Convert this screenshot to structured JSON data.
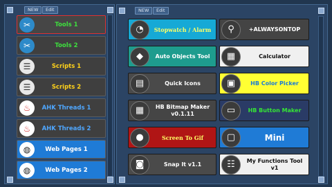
{
  "left": {
    "new_label": "NEW",
    "edit_label": "Edit",
    "items": [
      {
        "label": "Tools 1",
        "icon": "tools-icon",
        "bg": "#3f3f3f",
        "fg": "#3ee03e",
        "selected": true
      },
      {
        "label": "Tools 2",
        "icon": "tools-icon",
        "bg": "#3f3f3f",
        "fg": "#3ee03e"
      },
      {
        "label": "Scripts 1",
        "icon": "script-icon",
        "bg": "#3f3f3f",
        "fg": "#ffd11a"
      },
      {
        "label": "Scripts 2",
        "icon": "script-icon",
        "bg": "#3f3f3f",
        "fg": "#ffd11a"
      },
      {
        "label": "AHK Threads 1",
        "icon": "fire-icon",
        "bg": "#3f3f3f",
        "fg": "#4fa7ff"
      },
      {
        "label": "AHK Threads 2",
        "icon": "fire-icon",
        "bg": "#3f3f3f",
        "fg": "#4fa7ff"
      },
      {
        "label": "Web Pages 1",
        "icon": "globe-icon",
        "bg": "#1f7bd6",
        "fg": "#ffffff"
      },
      {
        "label": "Web Pages 2",
        "icon": "globe-icon",
        "bg": "#1f7bd6",
        "fg": "#ffffff"
      }
    ]
  },
  "right": {
    "new_label": "NEW",
    "edit_label": "Edit",
    "tiles": [
      {
        "label": "Stopwatch / Alarm",
        "icon": "stopwatch-icon",
        "bg": "#16a9d6",
        "fg": "#ffff66",
        "fontFamily": "serif"
      },
      {
        "label": "+ALWAYSONTOP",
        "icon": "pin-icon",
        "bg": "#444444",
        "fg": "#ffffff"
      },
      {
        "label": "Auto Objects Tool",
        "icon": "cube-icon",
        "bg": "#1e9c8e",
        "fg": "#ffffff"
      },
      {
        "label": "Calculator",
        "icon": "calculator-icon",
        "bg": "#f0f0f0",
        "fg": "#111111"
      },
      {
        "label": "Quick Icons",
        "icon": "grid-icon",
        "bg": "#4a4a4a",
        "fg": "#ffffff"
      },
      {
        "label": "HB Color Picker",
        "icon": "color-picker-icon",
        "bg": "#ffff33",
        "fg": "#1a7bd6"
      },
      {
        "label": "HB Bitmap Maker v0.1.11",
        "icon": "bitmap-icon",
        "bg": "#454545",
        "fg": "#ffffff"
      },
      {
        "label": "HB Button Maker",
        "icon": "button-maker-icon",
        "bg": "#2a3b66",
        "fg": "#35e535"
      },
      {
        "label": "Screen To Gif",
        "icon": "record-icon",
        "bg": "#b01515",
        "fg": "#ffff66",
        "fontFamily": "serif"
      },
      {
        "label": "Mini",
        "icon": "mini-icon",
        "bg": "#1f7bd6",
        "fg": "#ffffff",
        "large": true
      },
      {
        "label": "Snap It v1.1",
        "icon": "camera-icon",
        "bg": "#4a4a4a",
        "fg": "#ffffff"
      },
      {
        "label": "My Functions Tool v1",
        "icon": "document-icon",
        "bg": "#f0f0f0",
        "fg": "#111111"
      }
    ]
  }
}
